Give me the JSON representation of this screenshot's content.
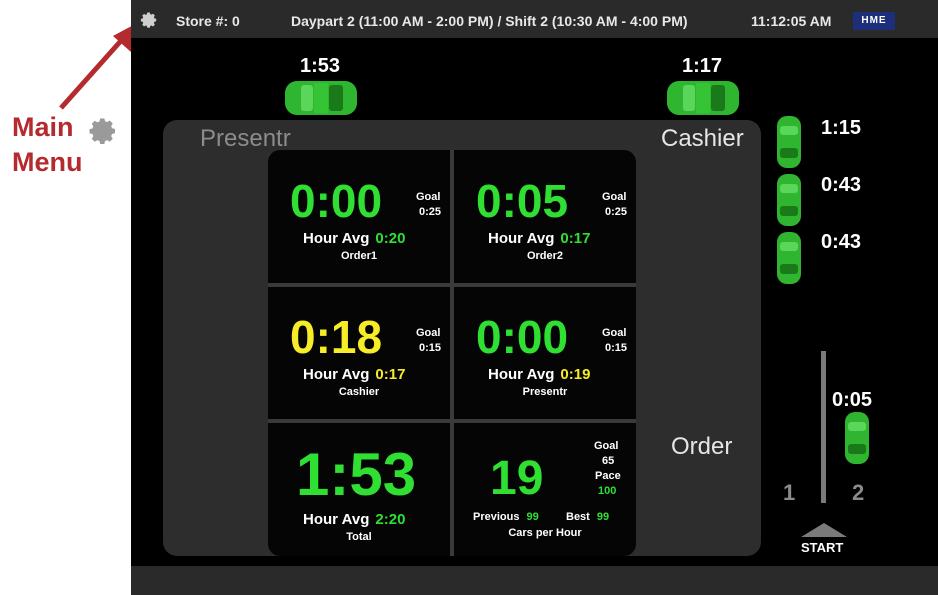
{
  "annotation": {
    "line1": "Main",
    "line2": "Menu",
    "arrow_color": "#b52a2e"
  },
  "topbar": {
    "store": "Store #: 0",
    "daypart": "Daypart 2 (11:00 AM - 2:00 PM) / Shift 2 (10:30 AM - 4:00 PM)",
    "time": "11:12:05 AM",
    "logo": "HME",
    "menu_icon": "gear-icon"
  },
  "zones": {
    "presentr": "Presentr",
    "cashier": "Cashier",
    "order": "Order"
  },
  "top_cars": [
    {
      "time": "1:53"
    },
    {
      "time": "1:17"
    }
  ],
  "queue_cars": [
    {
      "time": "1:15"
    },
    {
      "time": "0:43"
    },
    {
      "time": "0:43"
    }
  ],
  "lane": {
    "car_time": "0:05",
    "lane1": "1",
    "lane2": "2",
    "start": "START"
  },
  "cells": {
    "order1": {
      "value": "0:00",
      "goal_label": "Goal",
      "goal": "0:25",
      "havg_label": "Hour Avg",
      "havg": "0:20",
      "name": "Order1"
    },
    "order2": {
      "value": "0:05",
      "goal_label": "Goal",
      "goal": "0:25",
      "havg_label": "Hour Avg",
      "havg": "0:17",
      "name": "Order2"
    },
    "cashier": {
      "value": "0:18",
      "goal_label": "Goal",
      "goal": "0:15",
      "havg_label": "Hour Avg",
      "havg": "0:17",
      "name": "Cashier"
    },
    "presentr": {
      "value": "0:00",
      "goal_label": "Goal",
      "goal": "0:15",
      "havg_label": "Hour Avg",
      "havg": "0:19",
      "name": "Presentr"
    },
    "total": {
      "value": "1:53",
      "havg_label": "Hour Avg",
      "havg": "2:20",
      "name": "Total"
    },
    "cars": {
      "value": "19",
      "goal_label": "Goal",
      "goal": "65",
      "pace_label": "Pace",
      "pace": "100",
      "prev_label": "Previous",
      "prev": "99",
      "best_label": "Best",
      "best": "99",
      "name": "Cars per Hour"
    }
  },
  "colors": {
    "green": "#2fe033",
    "yellow": "#f6ec27",
    "car": "#2fb52f"
  }
}
